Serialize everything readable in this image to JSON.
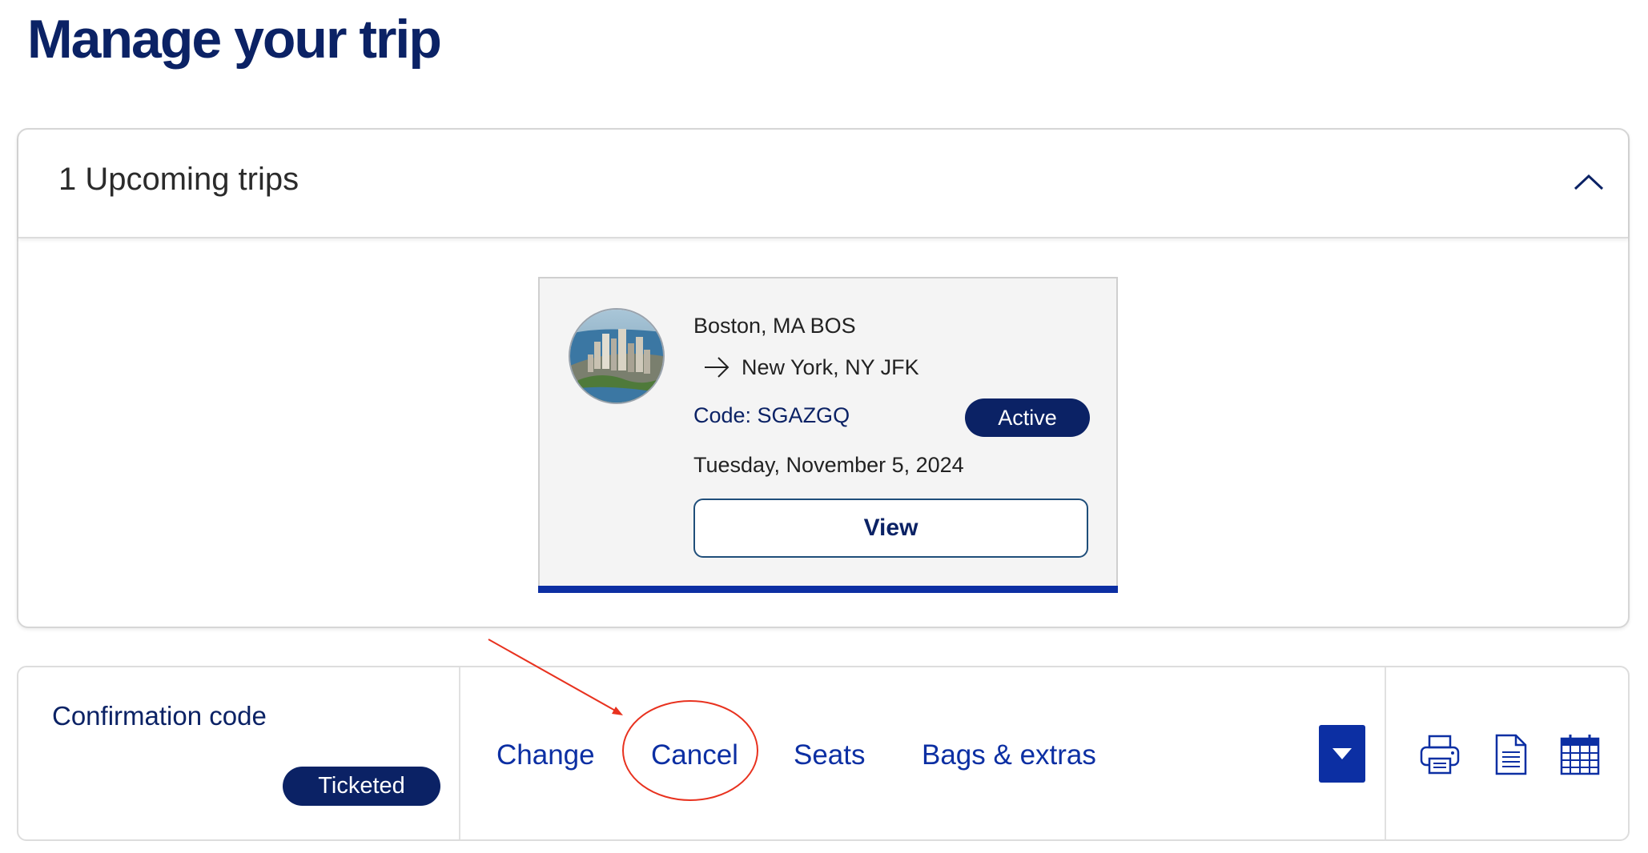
{
  "page": {
    "title": "Manage your trip"
  },
  "upcoming": {
    "heading": "1 Upcoming trips"
  },
  "trip_card": {
    "origin": "Boston, MA BOS",
    "destination": "New York, NY JFK",
    "code": "Code: SGAZGQ",
    "status": "Active",
    "date": "Tuesday, November 5, 2024",
    "view_label": "View"
  },
  "booking": {
    "confirmation_label": "Confirmation code",
    "ticket_status": "Ticketed",
    "actions": [
      "Change",
      "Cancel",
      "Seats",
      "Bags & extras"
    ],
    "tools": [
      "printer-icon",
      "document-icon",
      "calendar-icon"
    ]
  },
  "colors": {
    "brand_navy": "#0b2265",
    "link_blue": "#0c2fa3",
    "annotation_red": "#e8321f"
  }
}
